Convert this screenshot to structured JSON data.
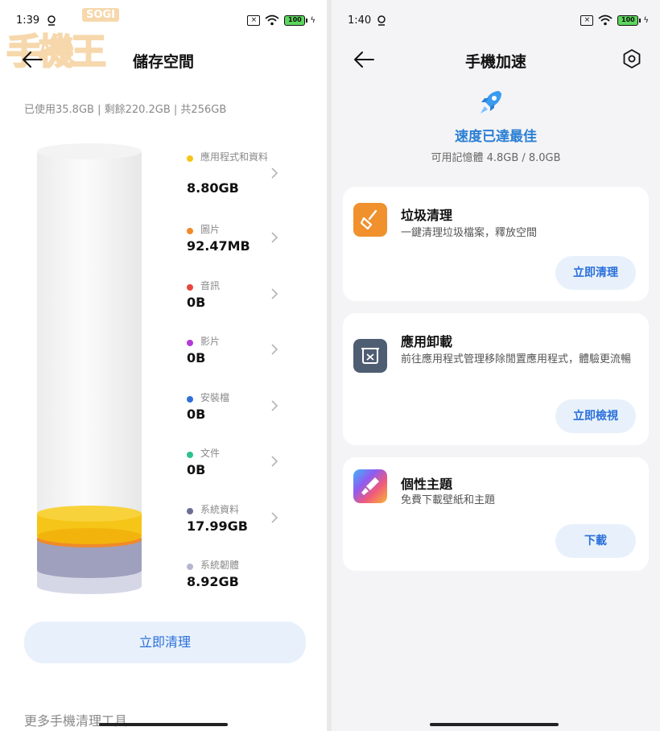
{
  "left_screen": {
    "status_bar": {
      "time": "1:39",
      "battery": "100"
    },
    "watermark": {
      "logo_badge": "SOGI",
      "logo_text": "手機王"
    },
    "header": {
      "title": "儲存空間"
    },
    "summary": "已使用35.8GB | 剩餘220.2GB | 共256GB",
    "storage_chart": {
      "type": "stacked-cylinder",
      "segments": [
        {
          "label": "應用程式和資料",
          "value": "8.80GB",
          "color": "#f5c518"
        },
        {
          "label": "圖片",
          "value": "92.47MB",
          "color": "#f08a2a"
        },
        {
          "label": "音訊",
          "value": "0B",
          "color": "#e8453c"
        },
        {
          "label": "影片",
          "value": "0B",
          "color": "#b23ad6"
        },
        {
          "label": "安裝檔",
          "value": "0B",
          "color": "#2f6fd8"
        },
        {
          "label": "文件",
          "value": "0B",
          "color": "#2cc18f"
        },
        {
          "label": "系統資料",
          "value": "17.99GB",
          "color": "#8e8fb0"
        },
        {
          "label": "系統韌體",
          "value": "8.92GB",
          "color": "#c8c9dd"
        }
      ]
    },
    "clean_button": "立即清理",
    "more_tools": "更多手機清理工具"
  },
  "right_screen": {
    "status_bar": {
      "time": "1:40",
      "battery": "100"
    },
    "header": {
      "title": "手機加速"
    },
    "speed_status": "速度已達最佳",
    "memory": "可用記憶體 4.8GB / 8.0GB",
    "cards": [
      {
        "title": "垃圾清理",
        "description": "一鍵清理垃圾檔案，釋放空間",
        "button": "立即清理",
        "icon": "broom-icon",
        "color": "#f0912e"
      },
      {
        "title": "應用卸載",
        "description": "前往應用程式管理移除閒置應用程式，體驗更流暢",
        "button": "立即檢視",
        "icon": "uninstall-icon",
        "color": "#4f5d73"
      },
      {
        "title": "個性主題",
        "description": "免費下載壁紙和主題",
        "button": "下載",
        "icon": "theme-brush-icon",
        "color": "#7a6cf0"
      }
    ]
  }
}
